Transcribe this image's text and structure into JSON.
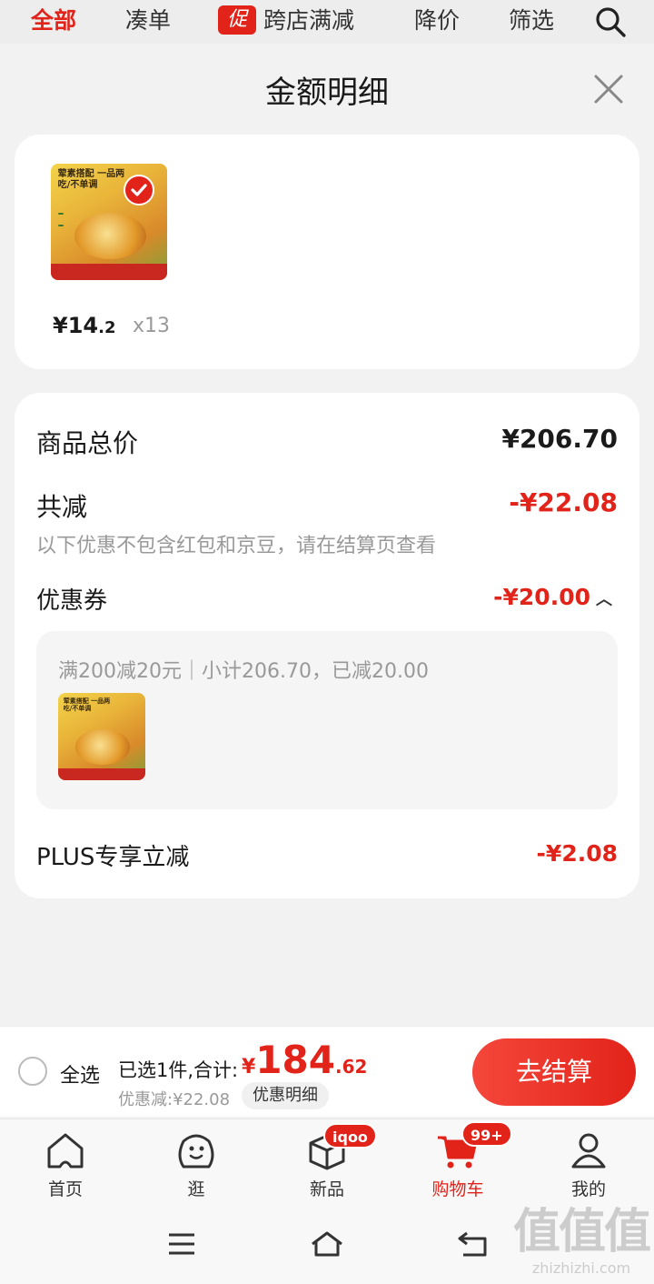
{
  "topbar": {
    "tabs": [
      "全部",
      "凑单",
      "跨店满减",
      "降价",
      "筛选"
    ],
    "promo_badge": "促"
  },
  "sheet": {
    "title": "金额明细",
    "item": {
      "price_int": "¥14",
      "price_dec": ".2",
      "quantity": "x13",
      "thumb_text": "荤素搭配 一品两吃/不单调"
    },
    "summary": {
      "total_label": "商品总价",
      "total_value": "¥206.70",
      "reduce_label": "共减",
      "reduce_value": "-¥22.08",
      "reduce_note": "以下优惠不包含红包和京豆，请在结算页查看",
      "coupon_label": "优惠券",
      "coupon_value": "-¥20.00",
      "coupon_detail": "满200减20元｜小计206.70，已减20.00",
      "plus_label": "PLUS专享立减",
      "plus_value": "-¥2.08"
    }
  },
  "checkout": {
    "select_all": "全选",
    "selected_label": "已选1件,合计:",
    "total_yen": "¥",
    "total_int": "184",
    "total_dec": ".62",
    "discount_text": "优惠减:¥22.08",
    "detail_button": "优惠明细",
    "pay_button": "去结算"
  },
  "tabbar": {
    "items": [
      "首页",
      "逛",
      "新品",
      "购物车",
      "我的"
    ],
    "new_badge": "iqoo",
    "cart_badge": "99+"
  },
  "watermark": {
    "logo": "值值值",
    "site": "zhizhizhi.com"
  },
  "colors": {
    "accent": "#e2231a",
    "muted": "#999999"
  }
}
